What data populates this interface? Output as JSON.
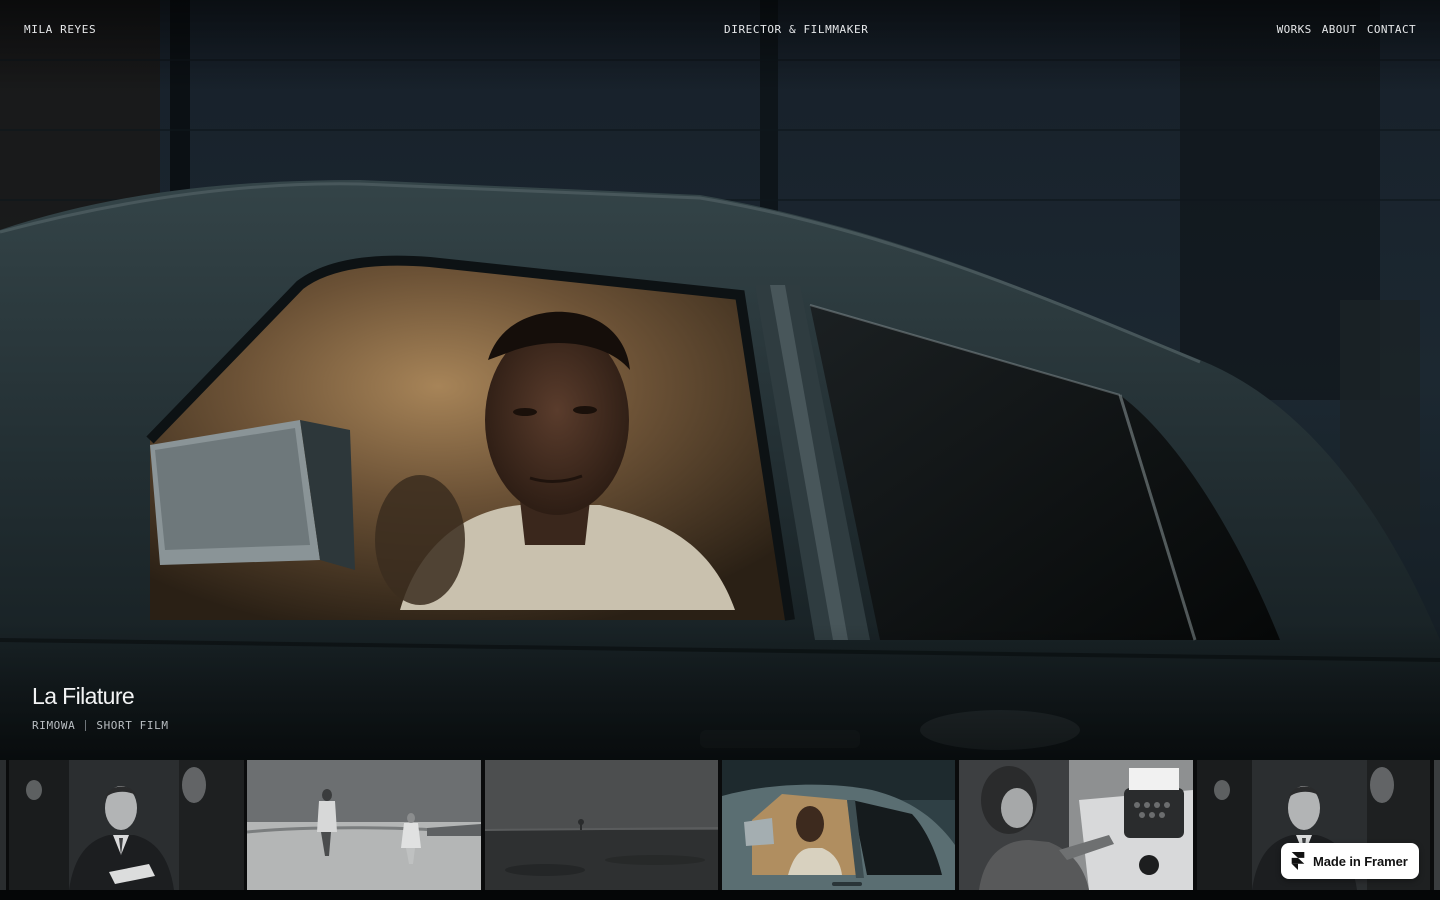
{
  "header": {
    "brand": "MILA REYES",
    "tagline": "DIRECTOR & FILMMAKER",
    "nav": [
      "WORKS",
      "ABOUT",
      "CONTACT"
    ]
  },
  "featured": {
    "title": "La Filature",
    "client": "RIMOWA",
    "category": "SHORT FILM"
  },
  "thumbnails": [
    {
      "scene": "man-in-suit-bar",
      "active": false
    },
    {
      "scene": "two-figures-field",
      "active": false
    },
    {
      "scene": "empty-landscape",
      "active": false
    },
    {
      "scene": "man-in-car",
      "active": true
    },
    {
      "scene": "typewriter-writer",
      "active": false
    },
    {
      "scene": "man-in-suit-bar",
      "active": false
    }
  ],
  "badge": {
    "label": "Made in Framer",
    "icon": "framer-logo-icon"
  },
  "colors": {
    "background": "#050607",
    "text": "#e6e8ea",
    "badge_bg": "#ffffff"
  }
}
